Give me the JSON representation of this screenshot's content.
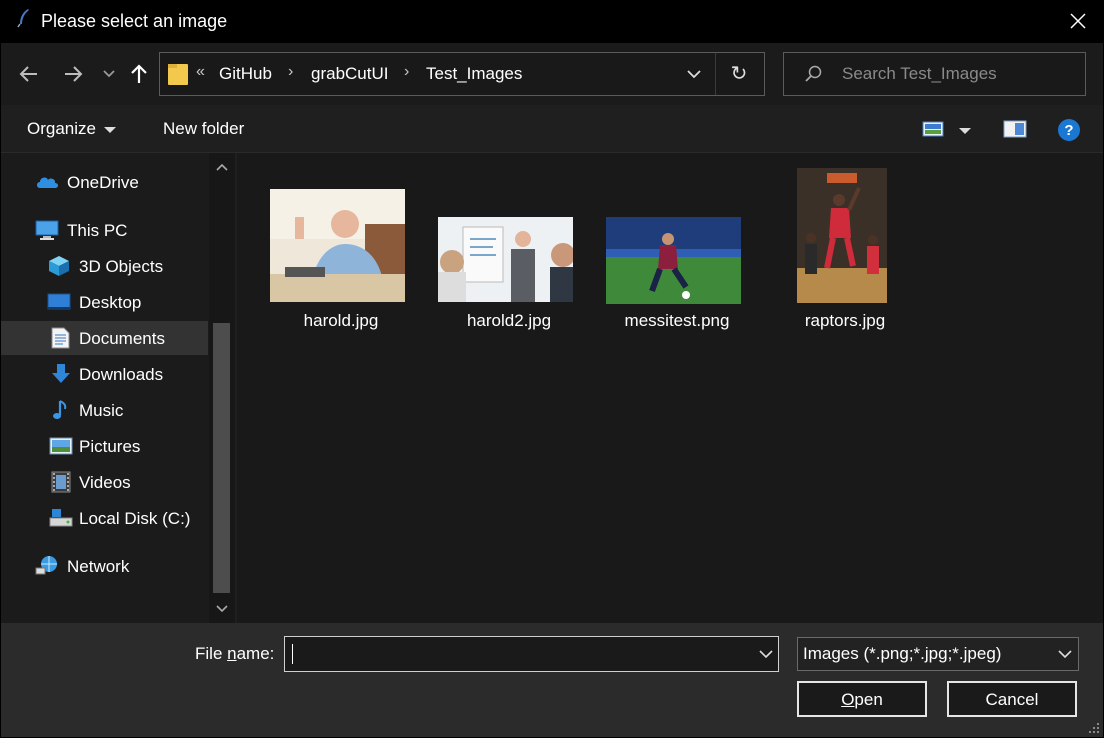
{
  "window": {
    "title": "Please select an image",
    "title_icon": "feather-icon",
    "close_icon": "close-icon"
  },
  "nav": {
    "back_icon": "arrow-left-icon",
    "forward_icon": "arrow-right-icon",
    "recent_icon": "chevron-down-icon",
    "up_icon": "arrow-up-icon",
    "overflow": "«",
    "breadcrumbs": [
      "GitHub",
      "grabCutUI",
      "Test_Images"
    ],
    "refresh_glyph": "↻",
    "search_placeholder": "Search Test_Images"
  },
  "commands": {
    "organize": "Organize",
    "new_folder": "New folder",
    "view_icon": "view-icon",
    "preview_icon": "preview-pane-icon",
    "help_glyph": "?"
  },
  "sidebar": {
    "items": [
      {
        "label": "OneDrive",
        "icon": "cloud-icon"
      },
      {
        "label": "This PC",
        "icon": "computer-icon"
      },
      {
        "label": "3D Objects",
        "icon": "cube-icon"
      },
      {
        "label": "Desktop",
        "icon": "desktop-icon"
      },
      {
        "label": "Documents",
        "icon": "document-icon",
        "selected": true
      },
      {
        "label": "Downloads",
        "icon": "download-icon"
      },
      {
        "label": "Music",
        "icon": "music-icon"
      },
      {
        "label": "Pictures",
        "icon": "pictures-icon"
      },
      {
        "label": "Videos",
        "icon": "video-icon"
      },
      {
        "label": "Local Disk (C:)",
        "icon": "drive-icon"
      },
      {
        "label": "Network",
        "icon": "network-icon"
      }
    ]
  },
  "files": [
    {
      "name": "harold.jpg"
    },
    {
      "name": "harold2.jpg"
    },
    {
      "name": "messitest.png"
    },
    {
      "name": "raptors.jpg"
    }
  ],
  "footer": {
    "filename_label_pre": "File ",
    "filename_label_underlined": "n",
    "filename_label_post": "ame:",
    "filename_value": "",
    "filter_value": "Images (*.png;*.jpg;*.jpeg)",
    "open_label_underlined": "O",
    "open_label_rest": "pen",
    "cancel_label": "Cancel"
  }
}
